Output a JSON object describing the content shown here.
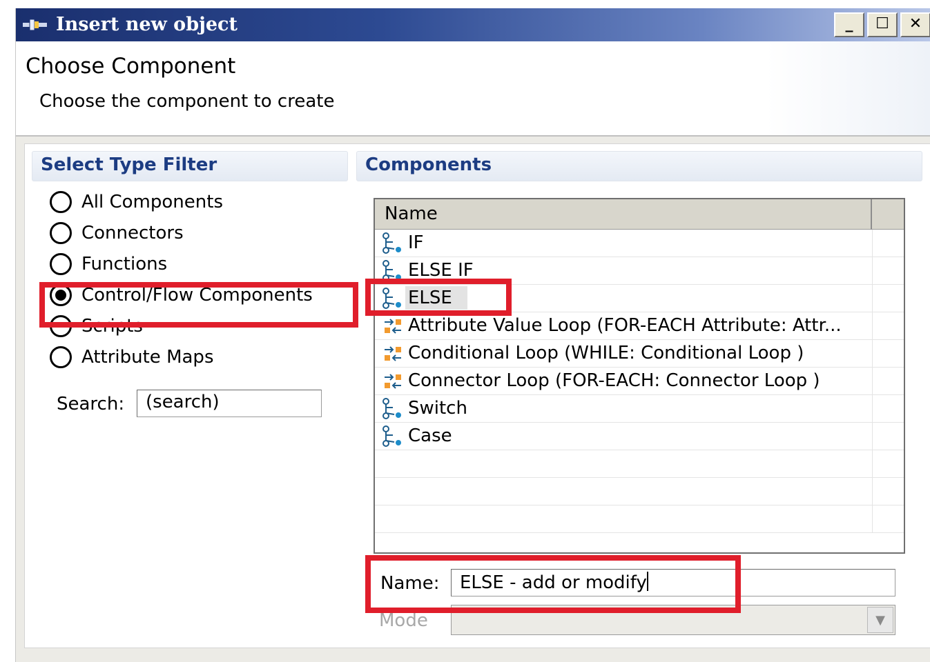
{
  "window": {
    "title": "Insert new object",
    "minimize_label": "_",
    "maximize_label": "☐",
    "close_label": "✕"
  },
  "header": {
    "title": "Choose Component",
    "description": "Choose the component to create"
  },
  "filter": {
    "heading": "Select Type Filter",
    "options": [
      {
        "label": "All Components",
        "checked": false
      },
      {
        "label": "Connectors",
        "checked": false
      },
      {
        "label": "Functions",
        "checked": false
      },
      {
        "label": "Control/Flow Components",
        "checked": true
      },
      {
        "label": "Scripts",
        "checked": false
      },
      {
        "label": "Attribute Maps",
        "checked": false
      }
    ],
    "search_label": "Search:",
    "search_value": "(search)"
  },
  "components": {
    "heading": "Components",
    "column_name": "Name",
    "rows": [
      {
        "label": "IF",
        "icon": "flow-icon"
      },
      {
        "label": "ELSE IF",
        "icon": "flow-icon"
      },
      {
        "label": "ELSE",
        "icon": "flow-icon",
        "selected": true
      },
      {
        "label": "Attribute Value Loop (FOR-EACH Attribute: Attr...",
        "icon": "loop-icon"
      },
      {
        "label": "Conditional Loop (WHILE: Conditional Loop )",
        "icon": "loop-icon"
      },
      {
        "label": "Connector Loop (FOR-EACH: Connector Loop )",
        "icon": "loop-icon"
      },
      {
        "label": "Switch",
        "icon": "flow-icon"
      },
      {
        "label": "Case",
        "icon": "flow-icon"
      }
    ]
  },
  "form": {
    "name_label": "Name:",
    "name_value": "ELSE - add or modify",
    "mode_label": "Mode",
    "mode_value": ""
  },
  "colors": {
    "highlight": "#e01e2b",
    "title_bar": "#1a2f6e",
    "section_heading": "#1c3c82"
  }
}
